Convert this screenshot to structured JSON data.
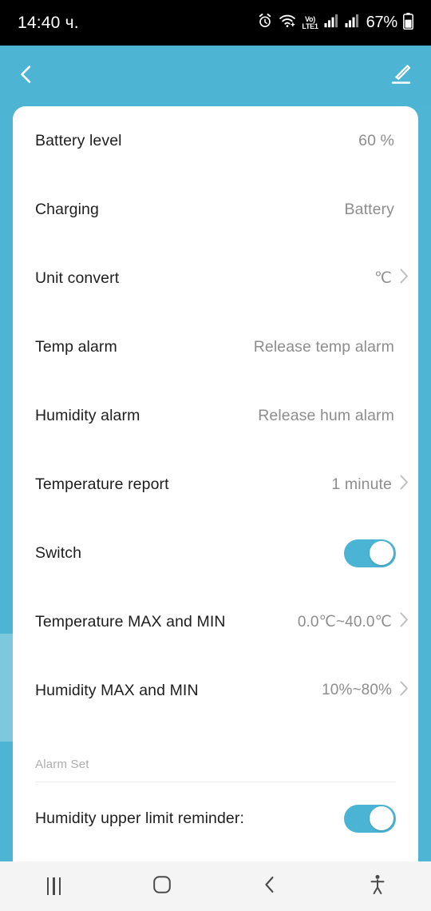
{
  "status_bar": {
    "time": "14:40 ч.",
    "battery_percent": "67%",
    "icons": [
      "alarm-icon",
      "wifi-icon",
      "volte-icon",
      "signal-icon-1",
      "signal-icon-2",
      "battery-icon"
    ],
    "volte_top": "Vo)",
    "volte_bottom": "LTE1"
  },
  "app_bar": {
    "back_icon": "back-chevron-icon",
    "edit_icon": "edit-pencil-icon",
    "background_color": "#4eb4d4"
  },
  "settings": {
    "rows": [
      {
        "label": "Battery level",
        "value": "60 %",
        "type": "value",
        "chevron": false
      },
      {
        "label": "Charging",
        "value": "Battery",
        "type": "value",
        "chevron": false
      },
      {
        "label": "Unit convert",
        "value": "℃",
        "type": "value",
        "chevron": true
      },
      {
        "label": "Temp alarm",
        "value": "Release temp alarm",
        "type": "value",
        "chevron": false
      },
      {
        "label": "Humidity alarm",
        "value": "Release hum alarm",
        "type": "value",
        "chevron": false
      },
      {
        "label": "Temperature report",
        "value": "1 minute",
        "type": "value",
        "chevron": true
      },
      {
        "label": "Switch",
        "value": "on",
        "type": "toggle",
        "chevron": false
      },
      {
        "label": "Temperature MAX and MIN",
        "value": "0.0℃~40.0℃",
        "type": "value",
        "chevron": true
      },
      {
        "label": "Humidity MAX and MIN",
        "value": "10%~80%",
        "type": "value",
        "chevron": true
      }
    ],
    "section": {
      "title": "Alarm Set",
      "rows": [
        {
          "label": "Humidity upper limit reminder:",
          "value": "on",
          "type": "toggle"
        }
      ],
      "clipped_row": {
        "label": "",
        "value": "on",
        "type": "toggle"
      }
    }
  },
  "nav_bar": {
    "recents_label": "recents-icon",
    "home_label": "home-icon",
    "back_label": "back-icon",
    "accessibility_label": "accessibility-icon"
  },
  "colors": {
    "accent": "#4eb4d4",
    "toggle_on": "#4bb4d4",
    "label_text": "#1e1e1e",
    "value_text": "#8d8d8d",
    "section_text": "#adadad",
    "nav_background": "#f4f4f4"
  }
}
